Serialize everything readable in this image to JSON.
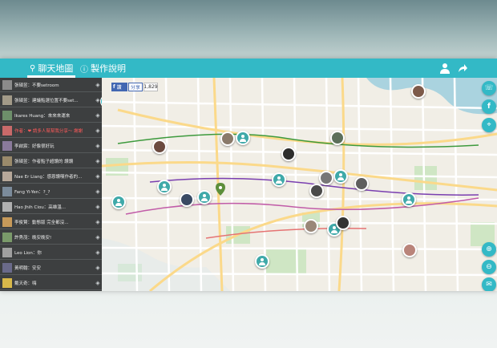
{
  "topbar": {
    "tab_map": "聊天地圖",
    "tab_about": "製作說明",
    "accent": "#33b9c6"
  },
  "sidebar": {
    "messages": [
      {
        "text": "張碩昱：不要setroom"
      },
      {
        "text": "張碩昱：建議點選位置不要set..."
      },
      {
        "text": "Ikares Huang：來來來運來"
      },
      {
        "text": "作者：❤ 請多人幫幫我分享～ 謝謝",
        "highlight": true
      },
      {
        "text": "李啟宸：好像很好玩"
      },
      {
        "text": "張碩昱：作者點子超讚的 讚讚"
      },
      {
        "text": "Nae Er Liang：感恩讚嘆作者的..."
      },
      {
        "text": "Fang Yi-Yen：?_?"
      },
      {
        "text": "Hao Jhih Ciou：高雄溫..."
      },
      {
        "text": "李俊賢：動態版 完全都沒..."
      },
      {
        "text": "許秀茂：晚安晚安!"
      },
      {
        "text": "Leo Lion：你"
      },
      {
        "text": "黃明翰：安安"
      },
      {
        "text": "戴天奇：嗨"
      }
    ]
  },
  "map": {
    "fb_like": "讚",
    "fb_share": "分享",
    "fb_count": "1,829"
  }
}
